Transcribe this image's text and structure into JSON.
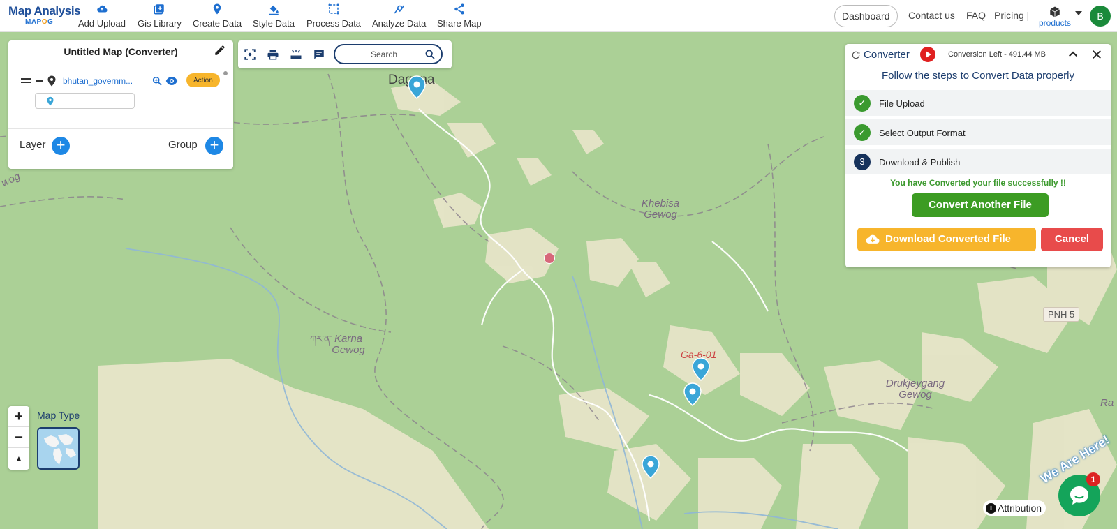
{
  "brand": {
    "title": "Map Analysis",
    "sub_a": "MAP",
    "sub_b": "O",
    "sub_c": "G"
  },
  "nav": [
    {
      "label": "Add Upload",
      "icon": "cloud-upload-icon"
    },
    {
      "label": "Gis Library",
      "icon": "library-icon"
    },
    {
      "label": "Create Data",
      "icon": "location-pin-icon"
    },
    {
      "label": "Style Data",
      "icon": "paint-bucket-icon"
    },
    {
      "label": "Process Data",
      "icon": "process-icon"
    },
    {
      "label": "Analyze Data",
      "icon": "analyze-icon"
    },
    {
      "label": "Share Map",
      "icon": "share-icon"
    }
  ],
  "header_right": {
    "dashboard": "Dashboard",
    "contact": "Contact us",
    "faq": "FAQ",
    "pricing": "Pricing |",
    "products": "products",
    "avatar_initial": "B"
  },
  "layer_panel": {
    "title": "Untitled Map (Converter)",
    "layer_name": "bhutan_governm...",
    "action_label": "Action",
    "layer_button": "Layer",
    "group_button": "Group"
  },
  "toolbar": {
    "search_placeholder": "Search"
  },
  "converter": {
    "title": "Converter",
    "conversion_left": "Conversion Left - 491.44 MB",
    "subtitle": "Follow the steps to Convert Data properly",
    "steps": [
      {
        "label": "File Upload",
        "status": "done"
      },
      {
        "label": "Select Output Format",
        "status": "done"
      },
      {
        "label": "Download & Publish",
        "status": "current",
        "number": "3"
      }
    ],
    "success_message": "You have Converted your file successfully !!",
    "convert_another": "Convert Another File",
    "download": "Download Converted File",
    "cancel": "Cancel"
  },
  "map": {
    "labels": {
      "dagana": "Dagana",
      "khebisa_1": "Khebisa",
      "khebisa_2": "Gewog",
      "karna_1": "Karna",
      "karna_2": "Gewog",
      "drukjeygang_1": "Drukjeygang",
      "drukjeygang_2": "Gewog",
      "ga601": "Ga-6-01",
      "wog": "wog",
      "ra": "Ra",
      "karna_script": "ཀར་ན་"
    },
    "road_shield": "PNH 5",
    "map_type_label": "Map Type",
    "zoom_in": "+",
    "zoom_out": "−",
    "compass": "▲"
  },
  "attribution": {
    "icon_text": "i",
    "label": "Attribution"
  },
  "chat": {
    "badge": "1",
    "tagline": "We Are Here!"
  },
  "colors": {
    "brand_blue": "#1c3d6e",
    "accent_blue": "#1e88e5",
    "success_green": "#3c9c23",
    "warning_orange": "#f7b52c",
    "danger_red": "#e84b4b",
    "map_green": "#a9cf94"
  }
}
